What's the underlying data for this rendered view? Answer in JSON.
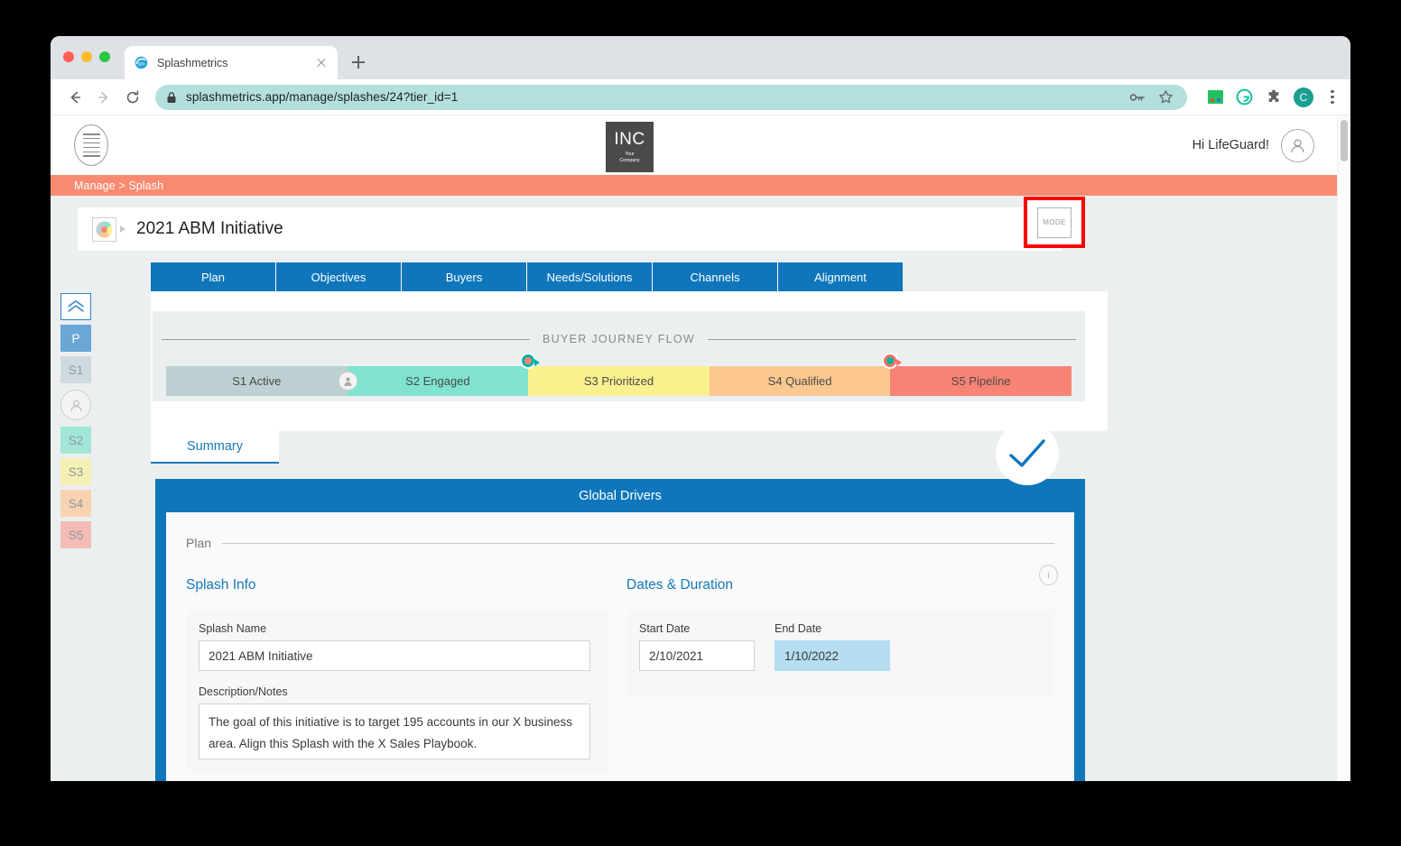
{
  "browser": {
    "tab": {
      "title": "Splashmetrics",
      "favicon_icon": "splashmetrics-favicon",
      "close_icon": "close-icon"
    },
    "newtab_icon": "plus-icon",
    "back_icon": "back-arrow-icon",
    "forward_icon": "forward-arrow-icon",
    "reload_icon": "reload-icon",
    "lock_icon": "lock-icon",
    "url": "splashmetrics.app/manage/splashes/24?tier_id=1",
    "omnibox_icons": [
      "key-icon",
      "star-icon"
    ],
    "extensions": [
      "color-square-extension-icon",
      "grammarly-extension-icon",
      "puzzle-extensions-icon"
    ],
    "profile_initial": "C",
    "menu_icon": "kebab-menu-icon"
  },
  "app": {
    "menu_icon": "hamburger-menu-icon",
    "logo": {
      "main": "INC",
      "sub_line1": "Your",
      "sub_line2": "Company"
    },
    "greeting": "Hi LifeGuard!",
    "user_icon": "user-avatar-icon",
    "breadcrumb": "Manage > Splash"
  },
  "title_strip": {
    "splash_icon": "splash-wheel-icon",
    "expand_icon": "caret-right-icon",
    "title": "2021 ABM Initiative",
    "mode_label": "MODE",
    "highlight_color": "#ff0000"
  },
  "nav_tabs": [
    {
      "label": "Plan"
    },
    {
      "label": "Objectives"
    },
    {
      "label": "Buyers"
    },
    {
      "label": "Needs/Solutions"
    },
    {
      "label": "Channels"
    },
    {
      "label": "Alignment"
    }
  ],
  "left_rail": {
    "collapse_icon": "double-chevron-up-icon",
    "chips": [
      {
        "label": "P",
        "class": "p"
      },
      {
        "label": "S1",
        "class": "s1"
      },
      {
        "label": "S2",
        "class": "s2"
      },
      {
        "label": "S3",
        "class": "s3"
      },
      {
        "label": "S4",
        "class": "s4"
      },
      {
        "label": "S5",
        "class": "s5"
      }
    ],
    "avatar_icon": "user-avatar-icon"
  },
  "journey": {
    "heading": "BUYER JOURNEY FLOW",
    "stages": [
      {
        "label": "S1 Active",
        "color": "#bdd0d2"
      },
      {
        "label": "S2 Engaged",
        "color": "#7fe3d0"
      },
      {
        "label": "S3 Prioritized",
        "color": "#fbf08e"
      },
      {
        "label": "S4 Qualified",
        "color": "#fbc890"
      },
      {
        "label": "S5 Pipeline",
        "color": "#f98375"
      }
    ],
    "stage_avatar_icon": "buyer-avatar-icon",
    "marker1_icon": "teal-stage-marker-icon",
    "marker2_icon": "salmon-stage-marker-icon"
  },
  "summary_tab": {
    "label": "Summary"
  },
  "check_badge": {
    "icon": "checkmark-icon",
    "color": "#0f76bc"
  },
  "global_drivers": {
    "title": "Global Drivers",
    "section_label": "Plan",
    "info_icon": "info-icon",
    "splash_info": {
      "heading": "Splash Info",
      "name_label": "Splash Name",
      "name_value": "2021 ABM Initiative",
      "description_label": "Description/Notes",
      "description_value": "The goal of this initiative is to target 195 accounts in our X business area. Align this Splash with the X Sales Playbook."
    },
    "dates": {
      "heading": "Dates & Duration",
      "start_label": "Start Date",
      "start_value": "2/10/2021",
      "end_label": "End Date",
      "end_value": "1/10/2022",
      "end_highlight_color": "#b5def2"
    }
  }
}
